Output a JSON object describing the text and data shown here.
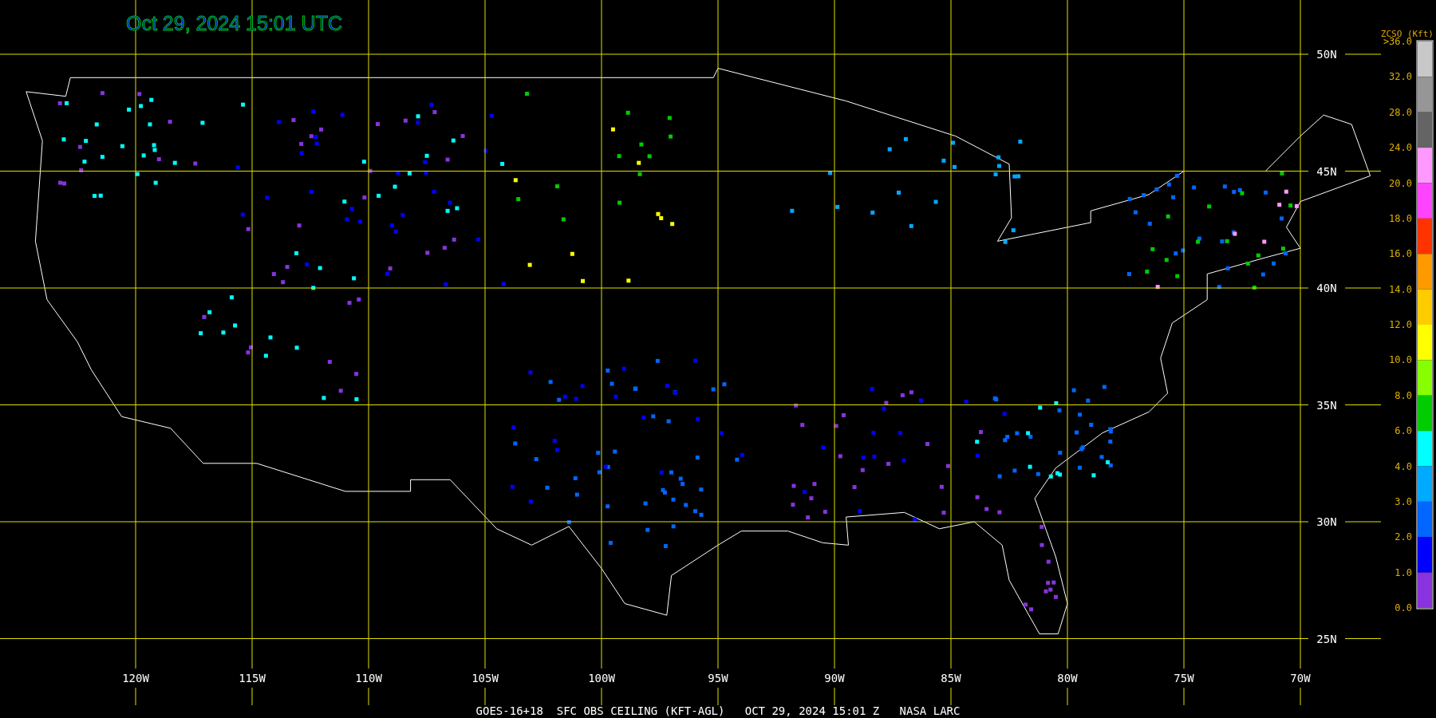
{
  "title": "Oct 29, 2024 15:01 UTC",
  "lon_labels": [
    "120W",
    "115W",
    "110W",
    "105W",
    "100W",
    "95W",
    "90W",
    "85W",
    "80W",
    "75W",
    "70W"
  ],
  "lat_labels": [
    "50N",
    "45N",
    "40N",
    "35N",
    "30N",
    "25N"
  ],
  "legend": {
    "title": "ZCSO (Kft)",
    "labels": [
      ">36.0",
      "32.0",
      "28.0",
      "24.0",
      "20.0",
      "18.0",
      "16.0",
      "14.0",
      "12.0",
      "10.0",
      "8.0",
      "6.0",
      "4.0",
      "3.0",
      "2.0",
      "1.0",
      "0.0"
    ],
    "segments": [
      {
        "color": "#c8c8c8"
      },
      {
        "color": "#969696"
      },
      {
        "color": "#646464"
      },
      {
        "color": "#ff99ff"
      },
      {
        "color": "#ff44ff"
      },
      {
        "color": "#ff3300"
      },
      {
        "color": "#ff9900"
      },
      {
        "color": "#ffcc00"
      },
      {
        "color": "#ffff00"
      },
      {
        "color": "#88ff00"
      },
      {
        "color": "#00cc00"
      },
      {
        "color": "#00ffff"
      },
      {
        "color": "#00aaff"
      },
      {
        "color": "#0066ff"
      },
      {
        "color": "#0000ff"
      },
      {
        "color": "#8833dd"
      }
    ]
  },
  "footer": "GOES-16+18  SFC OBS CEILING (KFT-AGL)   OCT 29, 2024 15:01 Z   NASA LARC"
}
